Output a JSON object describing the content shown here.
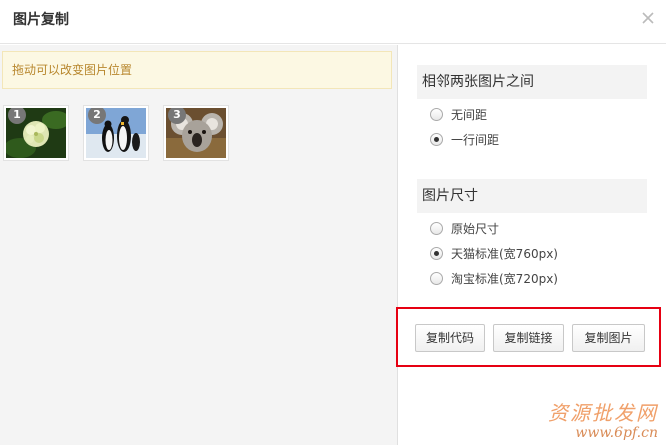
{
  "dialog": {
    "title": "图片复制",
    "close_icon": "close-icon"
  },
  "tip": {
    "text": "拖动可以改变图片位置"
  },
  "images": [
    {
      "index": "1",
      "subject": "flowers"
    },
    {
      "index": "2",
      "subject": "penguins"
    },
    {
      "index": "3",
      "subject": "koala"
    }
  ],
  "spacing": {
    "heading": "相邻两张图片之间",
    "options": [
      {
        "label": "无间距",
        "checked": false
      },
      {
        "label": "一行间距",
        "checked": true
      }
    ]
  },
  "size": {
    "heading": "图片尺寸",
    "options": [
      {
        "label": "原始尺寸",
        "checked": false
      },
      {
        "label": "天猫标准(宽760px)",
        "checked": true
      },
      {
        "label": "淘宝标准(宽720px)",
        "checked": false
      }
    ]
  },
  "actions": {
    "copy_code": "复制代码",
    "copy_link": "复制链接",
    "copy_image": "复制图片"
  },
  "colors": {
    "highlight_box": "#e60012",
    "tip_bg": "#fcf8e3",
    "tip_text": "#b8872e"
  },
  "watermark": {
    "line1": "资源批发网",
    "line2": "www.6pf.cn"
  }
}
